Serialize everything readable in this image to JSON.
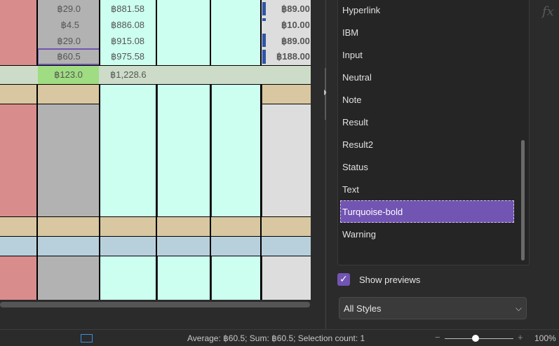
{
  "sheet": {
    "col_b": [
      "฿29.0",
      "฿4.5",
      "฿29.0",
      "฿60.5"
    ],
    "col_c": [
      "฿881.58",
      "฿886.08",
      "฿915.08",
      "฿975.58"
    ],
    "col_g": [
      "฿89.00",
      "฿10.00",
      "฿89.00",
      "฿188.00"
    ],
    "total_b": "฿123.0",
    "total_c": "฿1,228.6"
  },
  "styles_panel": {
    "items": [
      "Hyperlink",
      "IBM",
      "Input",
      "Neutral",
      "Note",
      "Result",
      "Result2",
      "Status",
      "Text",
      "Turquoise-bold",
      "Warning"
    ],
    "selected_index": 9,
    "fx_label": "fx",
    "show_previews_label": "Show previews",
    "show_previews_checked": true,
    "check_glyph": "✓",
    "filter_value": "All Styles",
    "chevron_glyph": "⌵"
  },
  "status_bar": {
    "text": "Average: ฿60.5; Sum: ฿60.5; Selection count: 1",
    "zoom_minus": "−",
    "zoom_plus": "+",
    "zoom": "100%",
    "zoom_fraction": 0.45
  },
  "colors": {
    "col_a_red": "#d98c8c",
    "col_b_gray": "#b2b2b2",
    "cyan_fill": "#ccfff0",
    "col_g_gray": "#dddddd",
    "tan_row": "#d8c7a0",
    "blue_row": "#b8d0dc",
    "total_row": "#cddcc8",
    "total_green": "#9fdc82",
    "accent_purple": "#7254b3",
    "data_bar_blue": "#2f55a4"
  }
}
